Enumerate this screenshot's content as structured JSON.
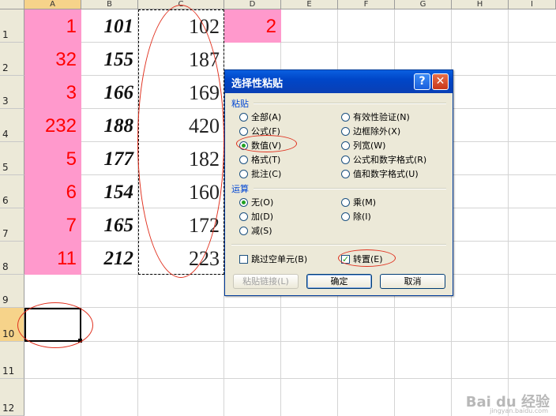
{
  "columns": [
    "A",
    "B",
    "C",
    "D",
    "E",
    "F",
    "G",
    "H",
    "I"
  ],
  "rows": [
    "1",
    "2",
    "3",
    "4",
    "5",
    "6",
    "7",
    "8",
    "9",
    "10",
    "11",
    "12"
  ],
  "colA": [
    "1",
    "32",
    "3",
    "232",
    "5",
    "6",
    "7",
    "11"
  ],
  "colB": [
    "101",
    "155",
    "166",
    "188",
    "177",
    "154",
    "165",
    "212"
  ],
  "colC": [
    "102",
    "187",
    "169",
    "420",
    "182",
    "160",
    "172",
    "223"
  ],
  "d1": "2",
  "dialog": {
    "title": "选择性粘贴",
    "help": "?",
    "close": "✕",
    "paste_group": "粘贴",
    "paste_left": [
      "全部(A)",
      "公式(F)",
      "数值(V)",
      "格式(T)",
      "批注(C)"
    ],
    "paste_right": [
      "有效性验证(N)",
      "边框除外(X)",
      "列宽(W)",
      "公式和数字格式(R)",
      "值和数字格式(U)"
    ],
    "op_group": "运算",
    "op_left": [
      "无(O)",
      "加(D)",
      "减(S)"
    ],
    "op_right": [
      "乘(M)",
      "除(I)"
    ],
    "skip_blanks": "跳过空单元(B)",
    "transpose": "转置(E)",
    "paste_link": "粘贴链接(L)",
    "ok": "确定",
    "cancel": "取消"
  },
  "watermark": "Bai du 经验",
  "watermark_url": "jingyan.baidu.com",
  "colors": {
    "pink": "#ff99cc",
    "red": "#ff0000",
    "title_blue": "#0046c8",
    "annotation": "#e0301e"
  }
}
